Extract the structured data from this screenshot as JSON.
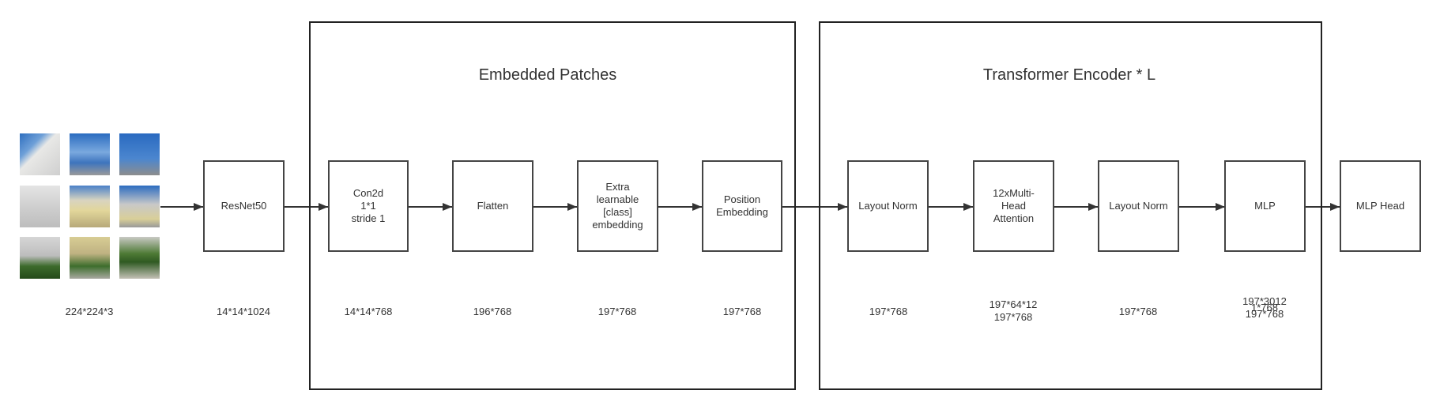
{
  "input": {
    "tile_count": 9,
    "dim": "224*224*3"
  },
  "backbone": {
    "label": "ResNet50",
    "dim": "14*14*1024"
  },
  "embedded_patches": {
    "title": "Embedded Patches",
    "blocks": [
      {
        "label": "Con2d\n1*1\nstride 1",
        "dim": "14*14*768"
      },
      {
        "label": "Flatten",
        "dim": "196*768"
      },
      {
        "label": "Extra\nlearnable\n[class]\nembedding",
        "dim": "197*768"
      },
      {
        "label": "Position\nEmbedding",
        "dim": "197*768"
      }
    ]
  },
  "transformer_encoder": {
    "title": "Transformer Encoder * L",
    "blocks": [
      {
        "label": "Layout Norm",
        "dim": "197*768"
      },
      {
        "label": "12xMulti-\nHead\nAttention",
        "dim": "197*64*12\n197*768"
      },
      {
        "label": "Layout Norm",
        "dim": "197*768"
      },
      {
        "label": "MLP",
        "dim": "197*3012\n1*768\n197*768"
      }
    ]
  },
  "head": {
    "label": "MLP Head"
  }
}
